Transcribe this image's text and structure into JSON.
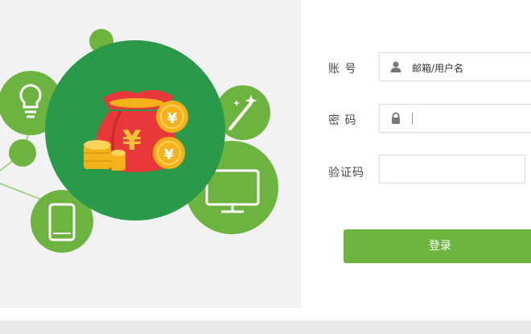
{
  "form": {
    "account_label": "账 号",
    "account_placeholder": "邮箱/用户名",
    "password_label": "密 码",
    "password_value": "",
    "captcha_label": "验证码",
    "captcha_value": "",
    "login_label": "登录"
  },
  "illustration": {
    "currency_symbol": "¥",
    "icons": [
      "lightbulb-icon",
      "magic-wand-icon",
      "monitor-icon",
      "tablet-icon",
      "money-bag-icon",
      "coin-icon"
    ]
  },
  "colors": {
    "brand_green": "#6db33f",
    "dark_green": "#2a9a4a",
    "panel_bg": "#f2f2f2",
    "bag_red": "#e8383a",
    "coin_gold": "#f5b11a"
  }
}
